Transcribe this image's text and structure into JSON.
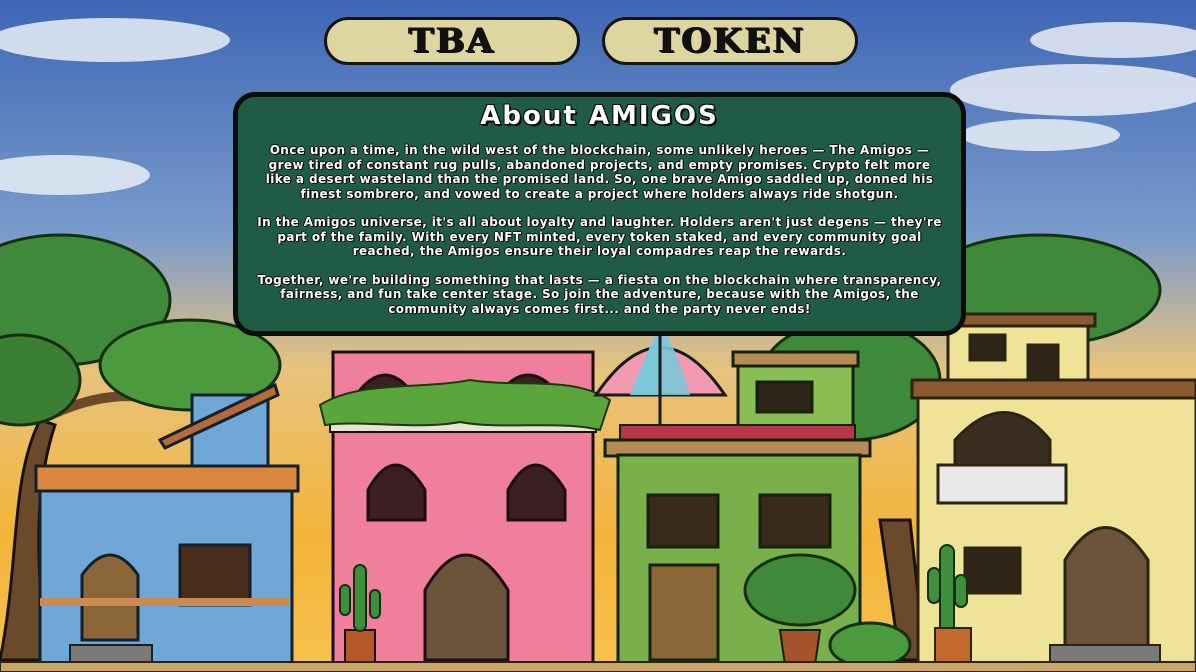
{
  "nav": {
    "tba_label": "TBA",
    "token_label": "TOKEN"
  },
  "about": {
    "title": "About AMIGOS",
    "paragraphs": [
      "Once upon a time, in the wild west of the blockchain, some unlikely heroes — The Amigos — grew tired of constant rug pulls, abandoned projects, and empty promises. Crypto felt more like a desert wasteland than the promised land. So, one brave Amigo saddled up, donned his finest sombrero, and vowed to create a project where holders always ride shotgun.",
      "In the Amigos universe, it's all about loyalty and laughter. Holders aren't just degens — they're part of the family. With every NFT minted, every token staked, and every community goal reached, the Amigos ensure their loyal compadres reap the rewards.",
      "Together, we're building something that lasts — a fiesta on the blockchain where transparency, fairness, and fun take center stage. So join the adventure, because with the Amigos, the community always comes first... and the party never ends!"
    ]
  },
  "colors": {
    "button_fill": "#ddd6a0",
    "panel_fill": "#1f5b45",
    "sky_top": "#3f6ab8",
    "sky_bottom": "#f3b23b"
  },
  "scene": {
    "description_icons": [
      "blue-house",
      "pink-house",
      "green-house",
      "yellow-house",
      "cactus",
      "umbrella",
      "tree"
    ]
  }
}
